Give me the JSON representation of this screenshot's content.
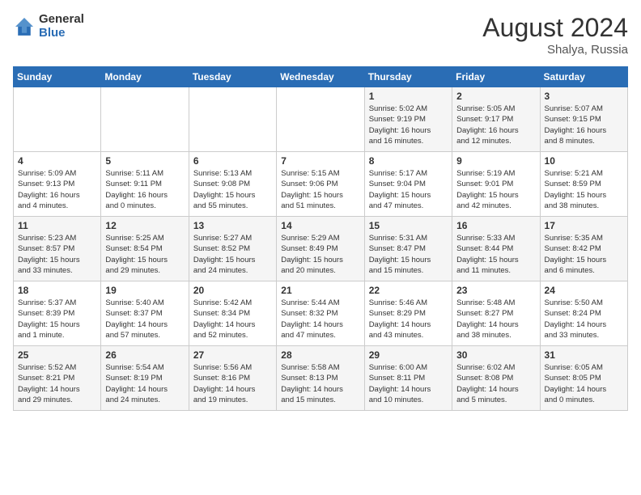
{
  "logo": {
    "general": "General",
    "blue": "Blue"
  },
  "title": {
    "month_year": "August 2024",
    "location": "Shalya, Russia"
  },
  "days_of_week": [
    "Sunday",
    "Monday",
    "Tuesday",
    "Wednesday",
    "Thursday",
    "Friday",
    "Saturday"
  ],
  "weeks": [
    [
      {
        "day": "",
        "info": ""
      },
      {
        "day": "",
        "info": ""
      },
      {
        "day": "",
        "info": ""
      },
      {
        "day": "",
        "info": ""
      },
      {
        "day": "1",
        "info": "Sunrise: 5:02 AM\nSunset: 9:19 PM\nDaylight: 16 hours\nand 16 minutes."
      },
      {
        "day": "2",
        "info": "Sunrise: 5:05 AM\nSunset: 9:17 PM\nDaylight: 16 hours\nand 12 minutes."
      },
      {
        "day": "3",
        "info": "Sunrise: 5:07 AM\nSunset: 9:15 PM\nDaylight: 16 hours\nand 8 minutes."
      }
    ],
    [
      {
        "day": "4",
        "info": "Sunrise: 5:09 AM\nSunset: 9:13 PM\nDaylight: 16 hours\nand 4 minutes."
      },
      {
        "day": "5",
        "info": "Sunrise: 5:11 AM\nSunset: 9:11 PM\nDaylight: 16 hours\nand 0 minutes."
      },
      {
        "day": "6",
        "info": "Sunrise: 5:13 AM\nSunset: 9:08 PM\nDaylight: 15 hours\nand 55 minutes."
      },
      {
        "day": "7",
        "info": "Sunrise: 5:15 AM\nSunset: 9:06 PM\nDaylight: 15 hours\nand 51 minutes."
      },
      {
        "day": "8",
        "info": "Sunrise: 5:17 AM\nSunset: 9:04 PM\nDaylight: 15 hours\nand 47 minutes."
      },
      {
        "day": "9",
        "info": "Sunrise: 5:19 AM\nSunset: 9:01 PM\nDaylight: 15 hours\nand 42 minutes."
      },
      {
        "day": "10",
        "info": "Sunrise: 5:21 AM\nSunset: 8:59 PM\nDaylight: 15 hours\nand 38 minutes."
      }
    ],
    [
      {
        "day": "11",
        "info": "Sunrise: 5:23 AM\nSunset: 8:57 PM\nDaylight: 15 hours\nand 33 minutes."
      },
      {
        "day": "12",
        "info": "Sunrise: 5:25 AM\nSunset: 8:54 PM\nDaylight: 15 hours\nand 29 minutes."
      },
      {
        "day": "13",
        "info": "Sunrise: 5:27 AM\nSunset: 8:52 PM\nDaylight: 15 hours\nand 24 minutes."
      },
      {
        "day": "14",
        "info": "Sunrise: 5:29 AM\nSunset: 8:49 PM\nDaylight: 15 hours\nand 20 minutes."
      },
      {
        "day": "15",
        "info": "Sunrise: 5:31 AM\nSunset: 8:47 PM\nDaylight: 15 hours\nand 15 minutes."
      },
      {
        "day": "16",
        "info": "Sunrise: 5:33 AM\nSunset: 8:44 PM\nDaylight: 15 hours\nand 11 minutes."
      },
      {
        "day": "17",
        "info": "Sunrise: 5:35 AM\nSunset: 8:42 PM\nDaylight: 15 hours\nand 6 minutes."
      }
    ],
    [
      {
        "day": "18",
        "info": "Sunrise: 5:37 AM\nSunset: 8:39 PM\nDaylight: 15 hours\nand 1 minute."
      },
      {
        "day": "19",
        "info": "Sunrise: 5:40 AM\nSunset: 8:37 PM\nDaylight: 14 hours\nand 57 minutes."
      },
      {
        "day": "20",
        "info": "Sunrise: 5:42 AM\nSunset: 8:34 PM\nDaylight: 14 hours\nand 52 minutes."
      },
      {
        "day": "21",
        "info": "Sunrise: 5:44 AM\nSunset: 8:32 PM\nDaylight: 14 hours\nand 47 minutes."
      },
      {
        "day": "22",
        "info": "Sunrise: 5:46 AM\nSunset: 8:29 PM\nDaylight: 14 hours\nand 43 minutes."
      },
      {
        "day": "23",
        "info": "Sunrise: 5:48 AM\nSunset: 8:27 PM\nDaylight: 14 hours\nand 38 minutes."
      },
      {
        "day": "24",
        "info": "Sunrise: 5:50 AM\nSunset: 8:24 PM\nDaylight: 14 hours\nand 33 minutes."
      }
    ],
    [
      {
        "day": "25",
        "info": "Sunrise: 5:52 AM\nSunset: 8:21 PM\nDaylight: 14 hours\nand 29 minutes."
      },
      {
        "day": "26",
        "info": "Sunrise: 5:54 AM\nSunset: 8:19 PM\nDaylight: 14 hours\nand 24 minutes."
      },
      {
        "day": "27",
        "info": "Sunrise: 5:56 AM\nSunset: 8:16 PM\nDaylight: 14 hours\nand 19 minutes."
      },
      {
        "day": "28",
        "info": "Sunrise: 5:58 AM\nSunset: 8:13 PM\nDaylight: 14 hours\nand 15 minutes."
      },
      {
        "day": "29",
        "info": "Sunrise: 6:00 AM\nSunset: 8:11 PM\nDaylight: 14 hours\nand 10 minutes."
      },
      {
        "day": "30",
        "info": "Sunrise: 6:02 AM\nSunset: 8:08 PM\nDaylight: 14 hours\nand 5 minutes."
      },
      {
        "day": "31",
        "info": "Sunrise: 6:05 AM\nSunset: 8:05 PM\nDaylight: 14 hours\nand 0 minutes."
      }
    ]
  ]
}
